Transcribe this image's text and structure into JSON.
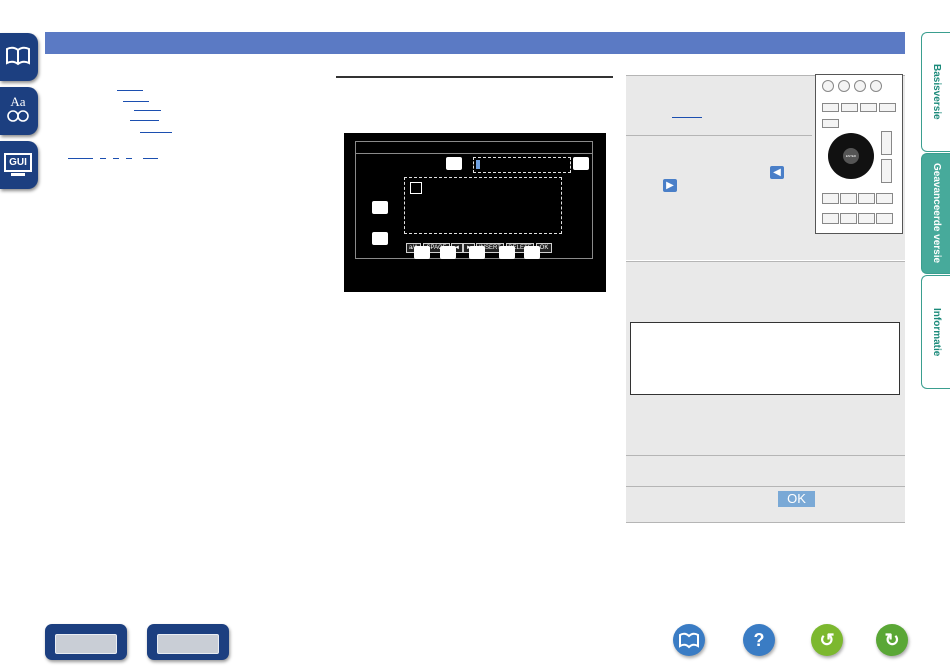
{
  "colors": {
    "nav_blue": "#1c3f80",
    "topbar_blue": "#5b7ac4",
    "tab_teal": "#47aa9b",
    "ok_blue": "#7aa9d6",
    "help_blue": "#3a7cc4",
    "back_green": "#7cb82f",
    "forward_green": "#5aa736"
  },
  "left_nav": [
    {
      "icon": "book-contents-icon"
    },
    {
      "icon": "glossary-aa-icon",
      "text": "Aa"
    },
    {
      "icon": "gui-icon",
      "text": "GUI"
    }
  ],
  "osd": {
    "callout_icon": "numbered-callout-icon",
    "keys": [
      "a/A",
      "SPACE",
      "◄",
      "►",
      "INSERT",
      "DELETE",
      "OK"
    ]
  },
  "right_tabs": [
    {
      "label": "Basisversie",
      "active": false
    },
    {
      "label": "Geavanceerde versie",
      "active": true
    },
    {
      "label": "Informatie",
      "active": false
    }
  ],
  "remote": {
    "center_label": "ENTER"
  },
  "ok_button": {
    "label": "OK"
  },
  "bottom_nav": [
    {
      "icon": "receiver-front-panel-icon"
    },
    {
      "icon": "receiver-rear-panel-icon"
    },
    {
      "icon": "book-contents-icon"
    },
    {
      "icon": "help-question-icon",
      "text": "?"
    },
    {
      "icon": "back-arrow-icon",
      "text": "↺"
    },
    {
      "icon": "forward-arrow-icon",
      "text": "↻"
    }
  ]
}
